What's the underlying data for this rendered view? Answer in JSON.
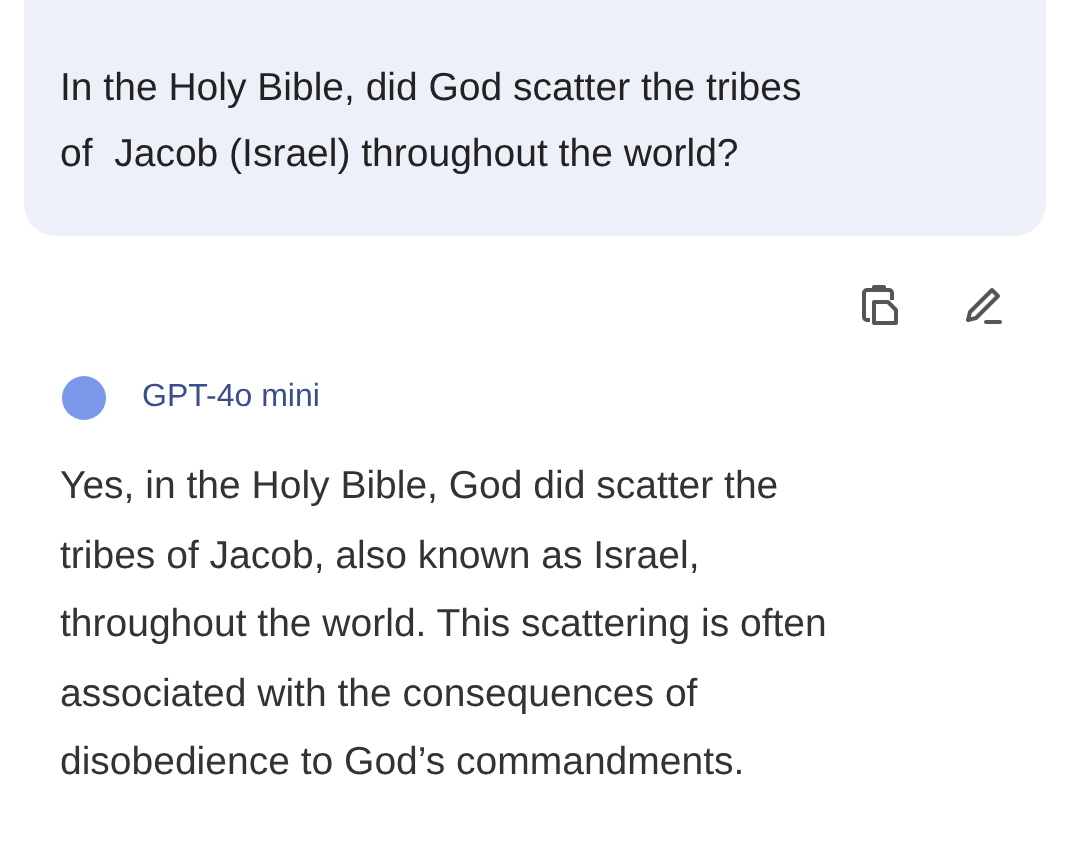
{
  "question": {
    "text": "In the Holy Bible, did God scatter the tribes\nof  Jacob (Israel) throughout the world?"
  },
  "actions": [
    {
      "kind": "copy"
    },
    {
      "kind": "edit"
    }
  ],
  "response": {
    "model": "GPT-4o mini",
    "color": "#7b97ea",
    "text": "Yes, in the Holy Bible, God did scatter the\ntribes of Jacob, also known as Israel,\nthroughout the world. This scattering is often\nassociated with the consequences of\ndisobedience to God’s commandments."
  }
}
